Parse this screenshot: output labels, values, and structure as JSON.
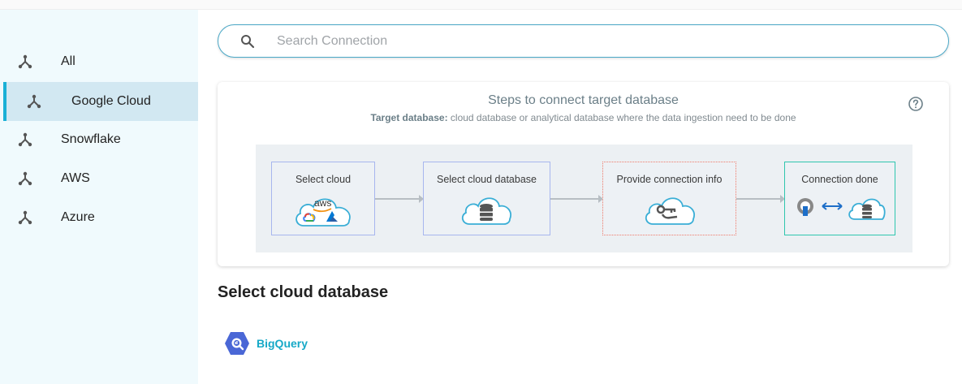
{
  "sidebar": {
    "items": [
      {
        "label": "All",
        "active": false
      },
      {
        "label": "Google Cloud",
        "active": true
      },
      {
        "label": "Snowflake",
        "active": false
      },
      {
        "label": "AWS",
        "active": false
      },
      {
        "label": "Azure",
        "active": false
      }
    ],
    "icon": "hub-icon",
    "active_color": "#1ab0d6"
  },
  "search": {
    "placeholder": "Search Connection",
    "value": ""
  },
  "steps_card": {
    "title": "Steps to connect target database",
    "subtitle_bold": "Target database:",
    "subtitle_rest": " cloud database or analytical database where the data ingestion need to be done",
    "steps": [
      {
        "label": "Select cloud",
        "aws_text": "aws"
      },
      {
        "label": "Select cloud database"
      },
      {
        "label": "Provide connection info"
      },
      {
        "label": "Connection done"
      }
    ]
  },
  "section": {
    "title": "Select cloud database"
  },
  "databases": [
    {
      "label": "BigQuery",
      "icon": "bigquery-icon",
      "color": "#16a9c7"
    }
  ]
}
